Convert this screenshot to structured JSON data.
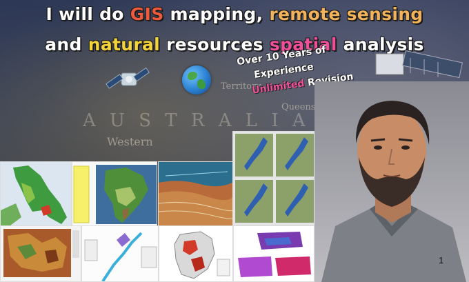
{
  "title": {
    "line1": {
      "w1": "I will do ",
      "w2": "GIS",
      "w3": " mapping, ",
      "w4": "remote sensing"
    },
    "line2": {
      "w1": "and ",
      "w2": "natural",
      "w3": " resources ",
      "w4": "spatial",
      "w5": " analysis"
    }
  },
  "experience": {
    "line1": "Over 10 Years of",
    "line2": "Experience",
    "line3_highlight": "Unlimited",
    "line3_rest": " Revision"
  },
  "map_labels": {
    "australia": "A U S T R A L I A",
    "western": "Western",
    "territory": "Territory",
    "queensland": "Queensland"
  },
  "page_number": "1",
  "colors": {
    "accent_red": "#f05a3c",
    "accent_orange": "#f2b35a",
    "accent_yellow": "#f3d43a",
    "accent_pink": "#f0509a"
  },
  "icons": {
    "globe": "globe-icon",
    "satellite": "satellite-icon"
  }
}
